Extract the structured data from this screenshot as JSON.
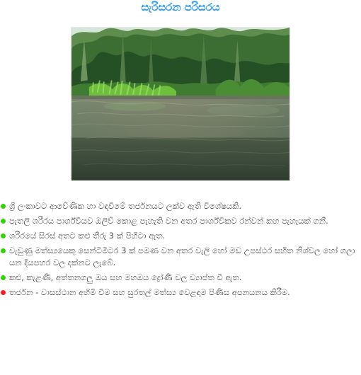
{
  "page": {
    "title": "සැරිසරන පරිසරය",
    "title_color": "#2f9df2",
    "accent_color": "#30d400",
    "warning_color": "#ff1d16"
  },
  "image": {
    "subject": "forest-stream-photo"
  },
  "points": [
    {
      "text": "ශ්‍රී ලංකාවට ආවේණික හා වඳවීමේ තර්ජනයට ලක්ව ඇති විශේෂයකි.",
      "bullet_color": "#30d400"
    },
    {
      "text": "පැතලි ශරීරය පාර්ශ්වීයව ඔලිව් කොළ පැහැති වන අතර පාර්ශ්විකව රන්වන් කහ පැහැයක් ගනී.",
      "bullet_color": "#30d400"
    },
    {
      "text": "ශරීරයේ සිරස් අතට කළු තීරු 3 ක් පිහිටා ඇත.",
      "bullet_color": "#30d400"
    },
    {
      "text": "වැඩුණු මත්ස්‍යයෙකු සෙන්ටිමීටර 3 ක් පමණ වන අතර වැලි හෝ මඩ උපස්ථර සහිත නිශ්චල හෝ ගලා යන දියපහර වල දක්නට ලැබේ.",
      "bullet_color": "#30d400"
    },
    {
      "text": "කළු, කැළණි, අත්තනගලු ඔය සහ මහඔය ද්‍රෝණි වල ව්‍යාප්ත වී ඇත.",
      "bullet_color": "#30d400"
    },
    {
      "text": "තර්ජන - වාසස්ථාන අහිමි වීම සහ සුරතල් මත්ස්‍ය වෙළඳාම පිණිස අපනයනය කිරීම.",
      "bullet_color": "#ff1d16"
    }
  ]
}
